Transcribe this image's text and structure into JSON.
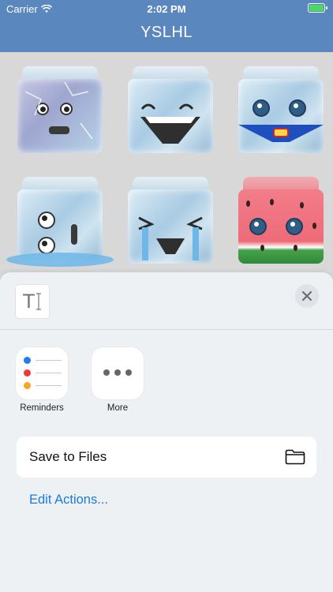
{
  "status": {
    "carrier": "Carrier",
    "time": "2:02 PM"
  },
  "nav": {
    "title": "YSLHL"
  },
  "stickers": [
    {
      "name": "angry-cracked-ice-cube"
    },
    {
      "name": "grinning-ice-cube"
    },
    {
      "name": "superhero-ice-cube"
    },
    {
      "name": "melting-ice-cube"
    },
    {
      "name": "crying-ice-cube"
    },
    {
      "name": "watermelon-cube"
    }
  ],
  "sheet": {
    "thumb_glyph": "T",
    "apps": [
      {
        "label": "Reminders",
        "icon": "reminders-icon"
      },
      {
        "label": "More",
        "icon": "more-icon"
      }
    ],
    "actions": [
      {
        "label": "Save to Files",
        "icon": "folder-icon"
      }
    ],
    "edit_actions": "Edit Actions...",
    "colors": {
      "accent": "#1a7bd8",
      "nav": "#5b87bf"
    }
  }
}
